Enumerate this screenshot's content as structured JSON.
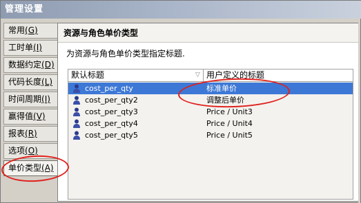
{
  "window": {
    "title": "管理设置"
  },
  "sidebar": {
    "items": [
      {
        "label": "常用",
        "mnemonic": "(G)"
      },
      {
        "label": "工时单",
        "mnemonic": "(I)"
      },
      {
        "label": "数据约定",
        "mnemonic": "(D)"
      },
      {
        "label": "代码长度",
        "mnemonic": "(L)"
      },
      {
        "label": "时间周期",
        "mnemonic": "(I)"
      },
      {
        "label": "赢得值",
        "mnemonic": "(V)"
      },
      {
        "label": "报表",
        "mnemonic": "(R)"
      },
      {
        "label": "选项",
        "mnemonic": "(O)"
      },
      {
        "label": "单价类型",
        "mnemonic": "(A)"
      }
    ],
    "selected_index": 8
  },
  "panel": {
    "title": "资源与角色单价类型",
    "description": "为资源与角色单价类型指定标题."
  },
  "table": {
    "columns": [
      "默认标题",
      "用户定义的标题"
    ],
    "rows": [
      {
        "default": "cost_per_qty",
        "user": "标准单价",
        "selected": true
      },
      {
        "default": "cost_per_qty2",
        "user": "调整后单价",
        "selected": false
      },
      {
        "default": "cost_per_qty3",
        "user": "Price / Unit3",
        "selected": false
      },
      {
        "default": "cost_per_qty4",
        "user": "Price / Unit4",
        "selected": false
      },
      {
        "default": "cost_per_qty5",
        "user": "Price / Unit5",
        "selected": false
      }
    ]
  },
  "icons": {
    "row_icon": "user-icon",
    "sort_icon": "sort-arrow-icon"
  },
  "colors": {
    "selection": "#3d78d6",
    "annotation": "#e0201c",
    "titlebar": "#a8b4c8"
  }
}
